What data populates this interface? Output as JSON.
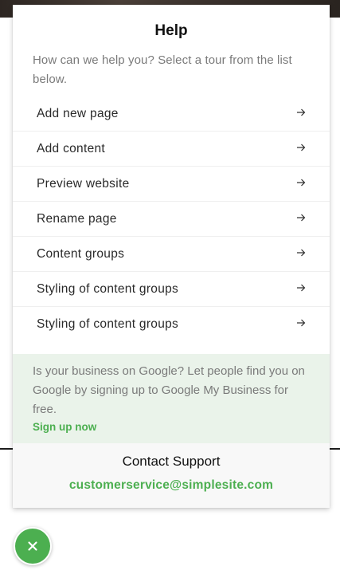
{
  "help": {
    "title": "Help",
    "subtitle": "How can we help you? Select a tour from the list below.",
    "tours": [
      {
        "label": "Add new page",
        "icon": "arrow-right-icon"
      },
      {
        "label": "Add content",
        "icon": "arrow-right-icon"
      },
      {
        "label": "Preview website",
        "icon": "arrow-right-icon"
      },
      {
        "label": "Rename page",
        "icon": "arrow-right-icon"
      },
      {
        "label": "Content groups",
        "icon": "arrow-right-icon"
      },
      {
        "label": "Styling of content groups",
        "icon": "arrow-right-icon"
      },
      {
        "label": "Styling of content groups",
        "icon": "arrow-right-icon"
      }
    ]
  },
  "promo": {
    "text": "Is your business on Google? Let people find you on Google by signing up to Google My Business for free.",
    "link": "Sign up now"
  },
  "support": {
    "title": "Contact Support",
    "email": "customerservice@simplesite.com"
  },
  "fab": {
    "icon": "close-icon"
  },
  "colors": {
    "accent": "#4caf50",
    "promo_bg": "#eaf3ea",
    "support_bg": "#f8f8f8"
  }
}
